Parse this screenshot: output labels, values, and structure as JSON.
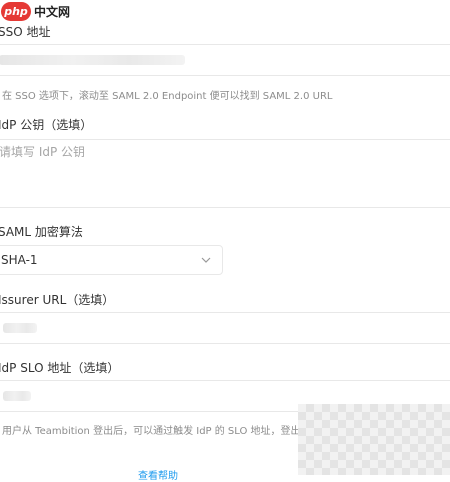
{
  "watermark": {
    "badge": "php",
    "text": "中文网"
  },
  "fields": {
    "sso_label": "SSO 地址",
    "sso_hint": "在 SSO 选项下，滚动至 SAML 2.0 Endpoint 便可以找到 SAML 2.0 URL",
    "idp_key_label": "IdP 公钥（选填）",
    "idp_key_placeholder": "请填写 IdP 公钥",
    "saml_algo_label": "SAML 加密算法",
    "saml_algo_value": "SHA-1",
    "issuer_label": "Issurer URL（选填）",
    "slo_label": "IdP SLO 地址（选填）",
    "slo_hint": "用户从 Teambition 登出后，可以通过触发 IdP 的 SLO 地址，登出账户",
    "bottom_link": "查看帮助"
  },
  "icons": {
    "select_arrow": "chevron-down-icon"
  }
}
